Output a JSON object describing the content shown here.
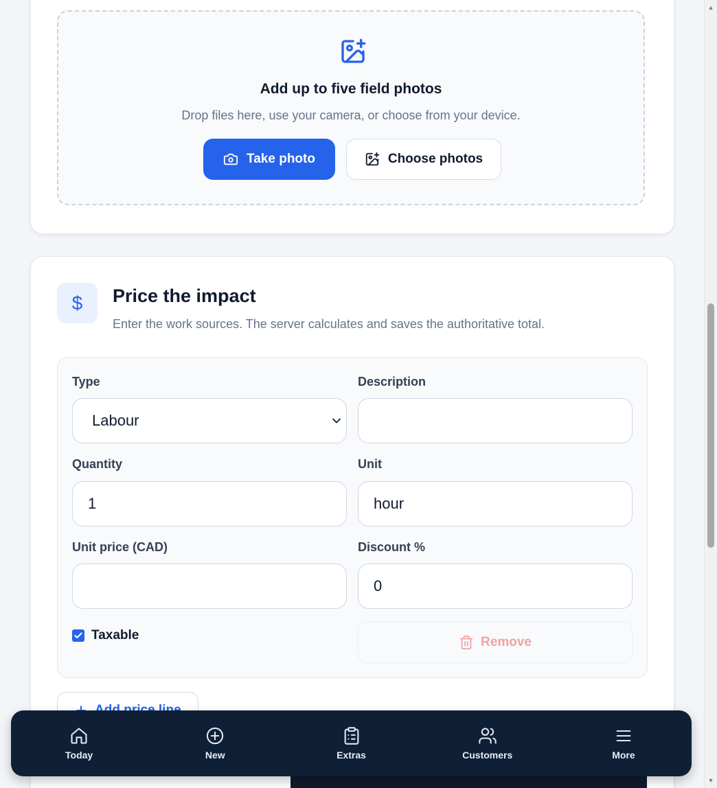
{
  "photos": {
    "title": "Add up to five field photos",
    "subtitle": "Drop files here, use your camera, or choose from your device.",
    "take_photo_label": "Take photo",
    "choose_photos_label": "Choose photos"
  },
  "price": {
    "icon": "$",
    "title": "Price the impact",
    "subtitle": "Enter the work sources. The server calculates and saves the authoritative total.",
    "line_item": {
      "type_label": "Type",
      "type_value": "Labour",
      "description_label": "Description",
      "description_value": "",
      "quantity_label": "Quantity",
      "quantity_value": "1",
      "unit_label": "Unit",
      "unit_value": "hour",
      "unit_price_label": "Unit price (CAD)",
      "unit_price_value": "",
      "discount_label": "Discount %",
      "discount_value": "0",
      "taxable_label": "Taxable",
      "taxable_checked": true,
      "remove_label": "Remove"
    },
    "add_line_label": "Add price line"
  },
  "nav": {
    "items": [
      {
        "label": "Today",
        "icon": "home-icon"
      },
      {
        "label": "New",
        "icon": "plus-circle-icon"
      },
      {
        "label": "Extras",
        "icon": "clipboard-icon"
      },
      {
        "label": "Customers",
        "icon": "users-icon"
      },
      {
        "label": "More",
        "icon": "menu-icon"
      }
    ]
  },
  "colors": {
    "accent": "#2563eb",
    "nav_bg": "#0f1f36",
    "danger_muted": "#f0a3a3"
  }
}
